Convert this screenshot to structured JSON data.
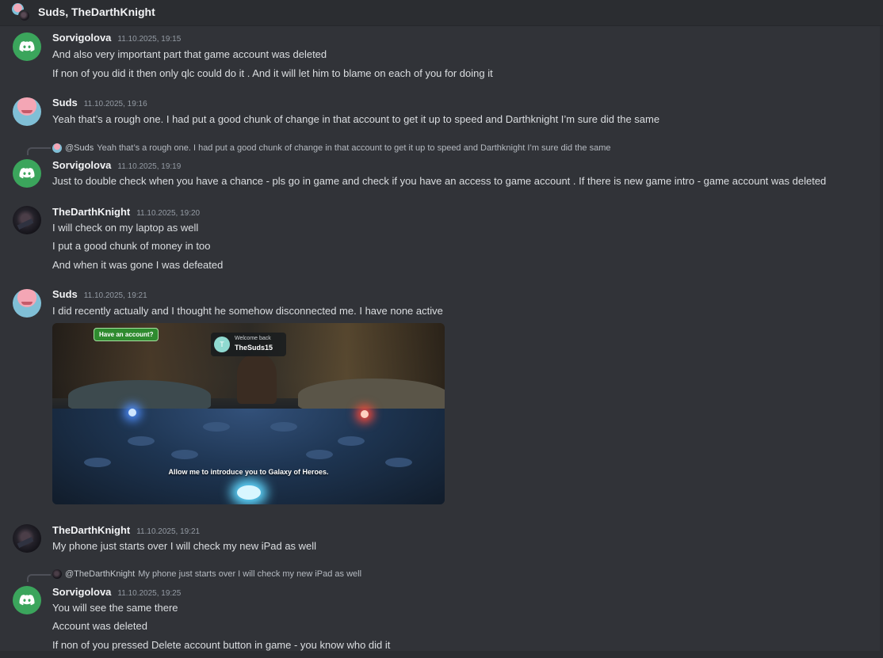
{
  "header": {
    "title": "Suds, TheDarthKnight"
  },
  "messages": [
    {
      "author": "Sorvigolova",
      "time": "11.10.2025, 19:15",
      "lines": [
        "And also very important part that game account was deleted",
        "If non of you did it then only  qlc could do it . And it will let him to blame on each of you for doing it"
      ]
    },
    {
      "author": "Suds",
      "time": "11.10.2025, 19:16",
      "lines": [
        "Yeah that’s a rough one. I had put a good chunk of change in that account to get it up to speed and Darthknight I’m sure did the same"
      ]
    },
    {
      "reply": {
        "user": "@Suds",
        "text": "Yeah that’s a rough one. I had put a good chunk of change in that account to get it up to speed and Darthknight I’m sure did the same"
      },
      "author": "Sorvigolova",
      "time": "11.10.2025, 19:19",
      "lines": [
        "Just to double check when you have a chance - pls go in game and check if you have an access to game account . If there is new game intro - game account was deleted"
      ]
    },
    {
      "author": "TheDarthKnight",
      "time": "11.10.2025, 19:20",
      "lines": [
        "I will check on my laptop as well",
        "I put a good chunk of money in too",
        "And when it was gone I was defeated"
      ]
    },
    {
      "author": "Suds",
      "time": "11.10.2025, 19:21",
      "lines": [
        "I did recently actually and I thought he somehow disconnected me. I have none active"
      ],
      "embed": {
        "has_account": "Have an account?",
        "welcome": "Welcome back",
        "player": "TheSuds15",
        "avatar_letter": "T",
        "caption": "Allow me to introduce you to Galaxy of Heroes."
      }
    },
    {
      "author": "TheDarthKnight",
      "time": "11.10.2025, 19:21",
      "lines": [
        "My phone just starts over I will check my new iPad as well"
      ]
    },
    {
      "reply": {
        "user": "@TheDarthKnight",
        "text": "My phone just starts over I will check my new iPad as well"
      },
      "author": "Sorvigolova",
      "time": "11.10.2025, 19:25",
      "lines": [
        "You will see the same there",
        "Account was deleted",
        "If non of you pressed Delete account button in game  - you know who did it"
      ]
    }
  ],
  "icons": {
    "bot_avatar": "discord-logo-icon",
    "group": "group-dm-icon"
  },
  "colors": {
    "background": "#313338",
    "header": "#2b2d31",
    "discord_green": "#3ba55c",
    "text": "#dbdee1",
    "muted": "#949ba4"
  }
}
